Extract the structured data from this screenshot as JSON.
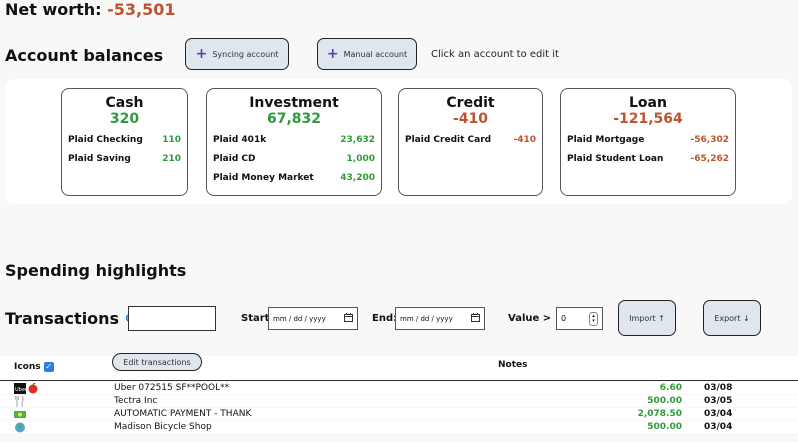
{
  "net_worth": {
    "label": "Net worth:",
    "value": "-53,501"
  },
  "balances": {
    "title": "Account balances",
    "syncing_btn": "Syncing account",
    "manual_btn": "Manual account",
    "hint": "Click an account to edit it"
  },
  "cards": [
    {
      "title": "Cash",
      "total": "320",
      "accounts": [
        {
          "name": "Plaid Checking",
          "amount": "110"
        },
        {
          "name": "Plaid Saving",
          "amount": "210"
        }
      ]
    },
    {
      "title": "Investment",
      "total": "67,832",
      "accounts": [
        {
          "name": "Plaid 401k",
          "amount": "23,632"
        },
        {
          "name": "Plaid CD",
          "amount": "1,000"
        },
        {
          "name": "Plaid Money Market",
          "amount": "43,200"
        }
      ]
    },
    {
      "title": "Credit",
      "total": "-410",
      "accounts": [
        {
          "name": "Plaid Credit Card",
          "amount": "-410"
        }
      ]
    },
    {
      "title": "Loan",
      "total": "-121,564",
      "accounts": [
        {
          "name": "Plaid Mortgage",
          "amount": "-56,302"
        },
        {
          "name": "Plaid Student Loan",
          "amount": "-65,262"
        }
      ]
    }
  ],
  "spending": {
    "title": "Spending highlights"
  },
  "transactions": {
    "title": "Transactions",
    "start_label": "Start:",
    "end_label": "End:",
    "date_placeholder": "mm / dd / yyyy",
    "value_label": "Value >",
    "value_input": "0",
    "import_btn": "Import ↑",
    "export_btn": "Export ↓",
    "col_icons": "Icons",
    "edit_btn": "Edit transactions",
    "col_notes": "Notes",
    "rows": [
      {
        "desc": "Uber 072515 SF**POOL**",
        "value": "6.60",
        "date": "03/08",
        "icon": "uber-apple-icon"
      },
      {
        "desc": "Tectra Inc",
        "value": "500.00",
        "date": "03/05",
        "icon": "fork-knife-icon"
      },
      {
        "desc": "AUTOMATIC PAYMENT - THANK",
        "value": "2,078.50",
        "date": "03/04",
        "icon": "money-icon"
      },
      {
        "desc": "Madison Bicycle Shop",
        "value": "500.00",
        "date": "03/04",
        "icon": "globe-icon"
      }
    ]
  },
  "colors": {
    "negative": "#c0532f",
    "positive": "#2e9b3a",
    "button_bg": "#dfe6ee"
  }
}
